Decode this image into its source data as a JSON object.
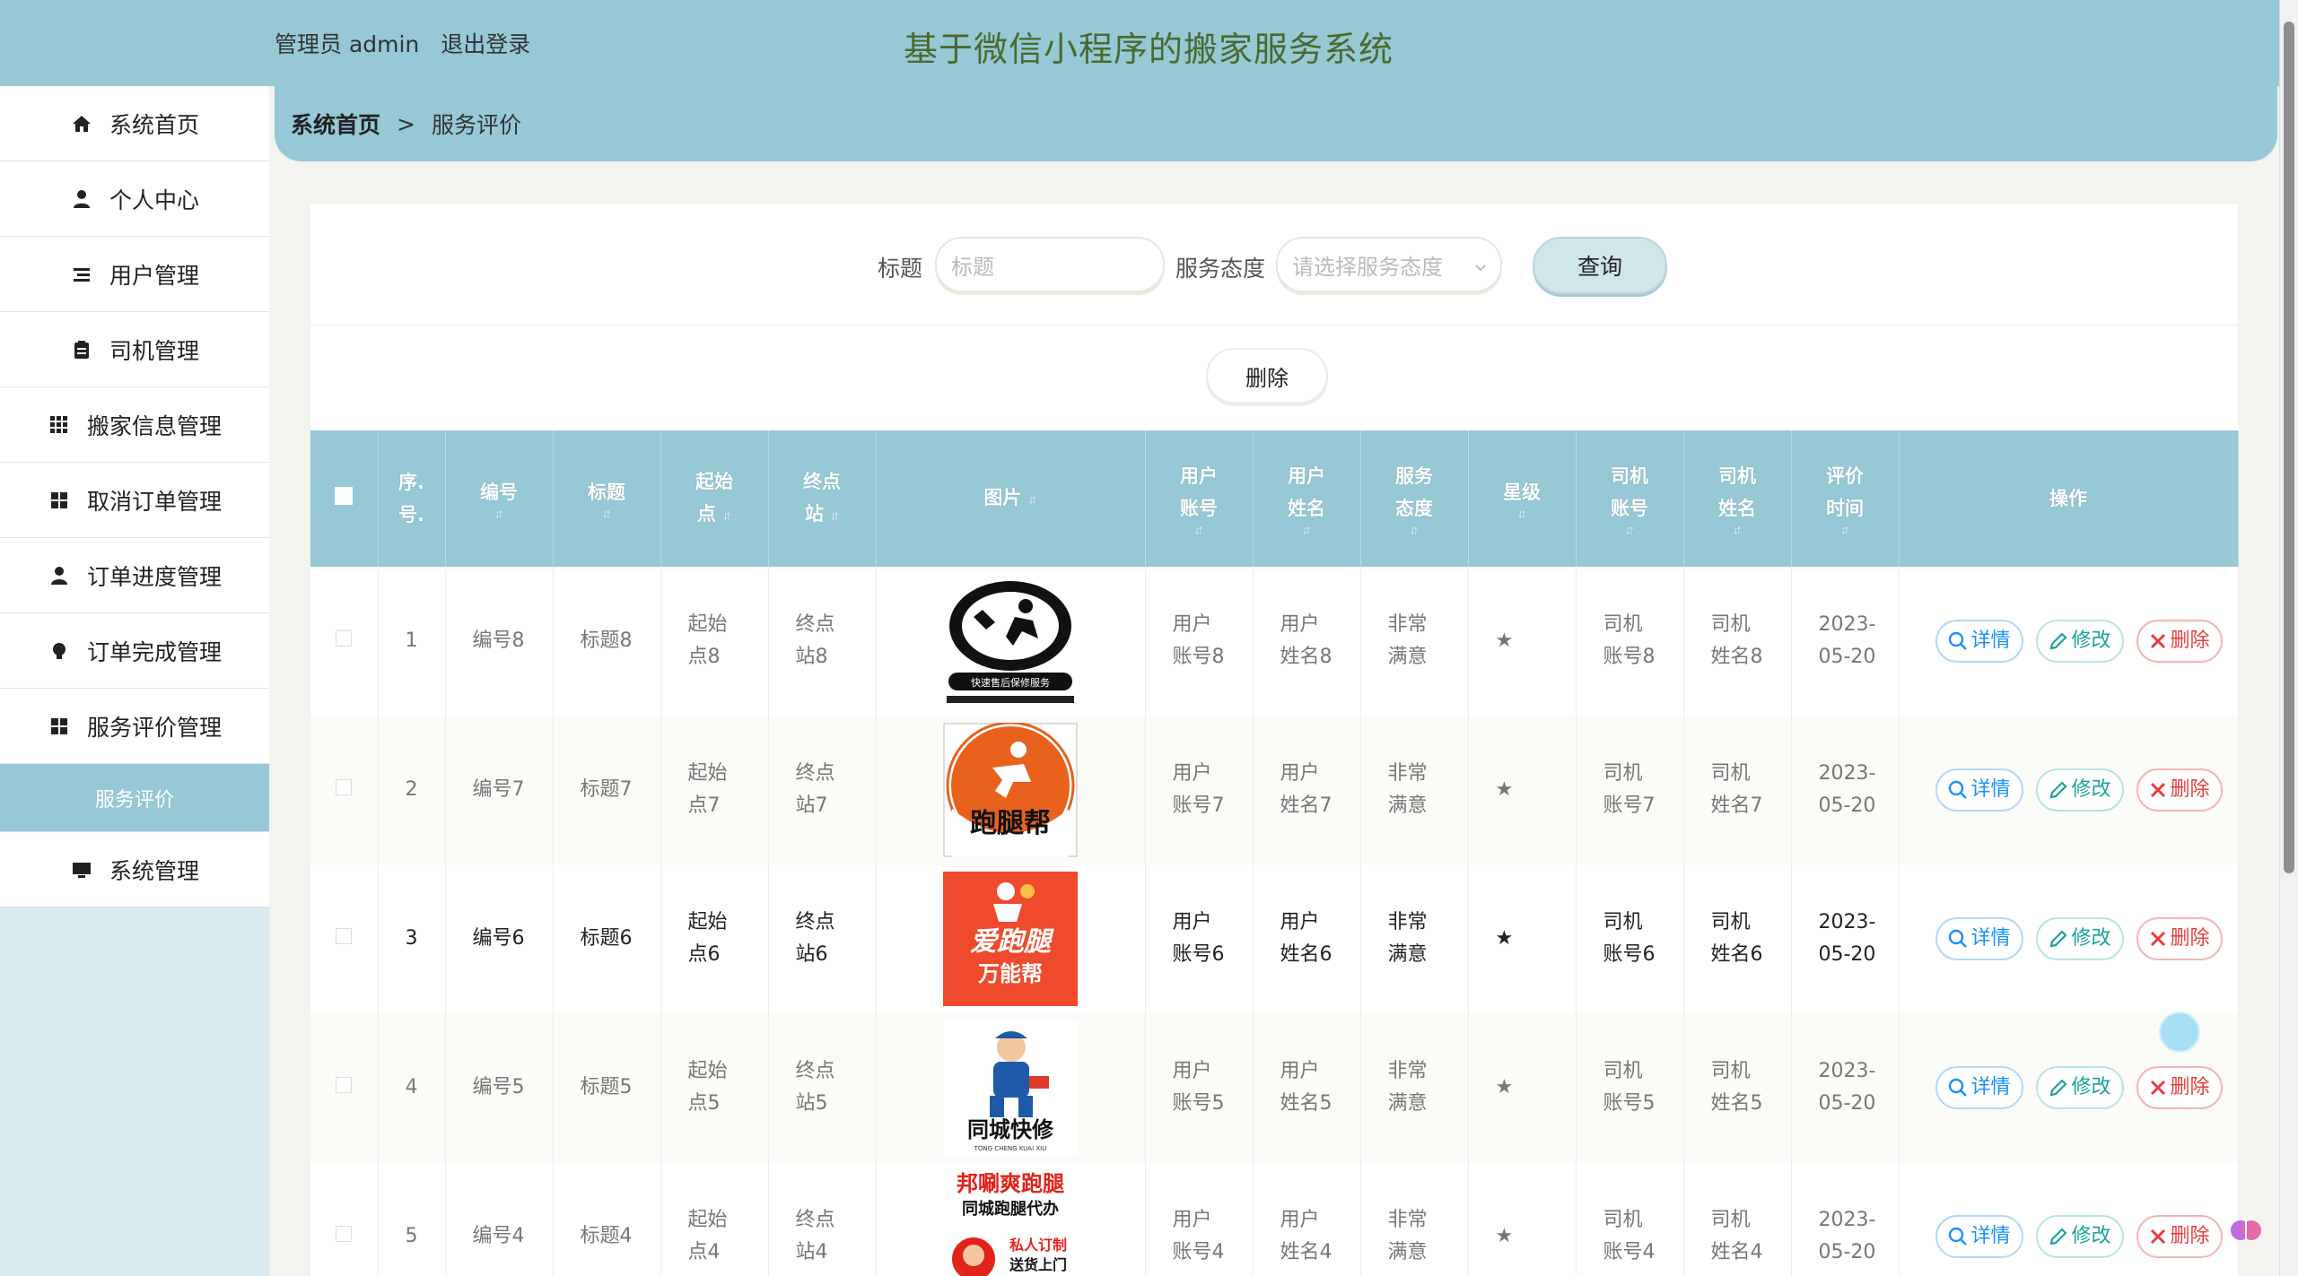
{
  "header": {
    "user_text": "管理员 admin",
    "logout": "退出登录",
    "title": "基于微信小程序的搬家服务系统"
  },
  "sidebar": {
    "items": [
      {
        "label": "系统首页",
        "icon": "home-icon"
      },
      {
        "label": "个人中心",
        "icon": "user-icon"
      },
      {
        "label": "用户管理",
        "icon": "list-icon"
      },
      {
        "label": "司机管理",
        "icon": "clipboard-icon"
      },
      {
        "label": "搬家信息管理",
        "icon": "grid-icon"
      },
      {
        "label": "取消订单管理",
        "icon": "apps-icon"
      },
      {
        "label": "订单进度管理",
        "icon": "person-icon"
      },
      {
        "label": "订单完成管理",
        "icon": "bulb-icon"
      },
      {
        "label": "服务评价管理",
        "icon": "apps-icon"
      }
    ],
    "sub_item": "服务评价",
    "last_item": {
      "label": "系统管理",
      "icon": "monitor-icon"
    }
  },
  "breadcrumb": {
    "home": "系统首页",
    "separator": ">",
    "current": "服务评价"
  },
  "search": {
    "title_label": "标题",
    "title_placeholder": "标题",
    "attitude_label": "服务态度",
    "attitude_placeholder": "请选择服务态度",
    "query_button": "查询"
  },
  "delete_button": "删除",
  "table": {
    "headers": [
      "序号.",
      "编号",
      "标题",
      "起始点",
      "终点站",
      "图片",
      "用户账号",
      "用户姓名",
      "服务态度",
      "星级",
      "司机账号",
      "司机姓名",
      "评价时间",
      "操作"
    ],
    "header_lines": {
      "index": [
        "序.",
        "号."
      ],
      "code": [
        "编号"
      ],
      "title": [
        "标题"
      ],
      "start": [
        "起始",
        "点"
      ],
      "end": [
        "终点",
        "站"
      ],
      "image": [
        "图片"
      ],
      "user_account": [
        "用户",
        "账号"
      ],
      "user_name": [
        "用户",
        "姓名"
      ],
      "attitude": [
        "服务",
        "态度"
      ],
      "stars": [
        "星级"
      ],
      "driver_account": [
        "司机",
        "账号"
      ],
      "driver_name": [
        "司机",
        "姓名"
      ],
      "time": [
        "评价",
        "时间"
      ],
      "ops": [
        "操作"
      ]
    },
    "rows": [
      {
        "index": "1",
        "code": "编号8",
        "title": "标题8",
        "start": [
          "起始",
          "点8"
        ],
        "end": [
          "终点",
          "站8"
        ],
        "image": "快速售后保修服务 logo",
        "user_account": [
          "用户",
          "账号8"
        ],
        "user_name": [
          "用户",
          "姓名8"
        ],
        "attitude": [
          "非常",
          "满意"
        ],
        "stars": "★",
        "driver_account": [
          "司机",
          "账号8"
        ],
        "driver_name": [
          "司机",
          "姓名8"
        ],
        "time": [
          "2023-",
          "05-20"
        ]
      },
      {
        "index": "2",
        "code": "编号7",
        "title": "标题7",
        "start": [
          "起始",
          "点7"
        ],
        "end": [
          "终点",
          "站7"
        ],
        "image": "跑腿帮",
        "user_account": [
          "用户",
          "账号7"
        ],
        "user_name": [
          "用户",
          "姓名7"
        ],
        "attitude": [
          "非常",
          "满意"
        ],
        "stars": "★",
        "driver_account": [
          "司机",
          "账号7"
        ],
        "driver_name": [
          "司机",
          "姓名7"
        ],
        "time": [
          "2023-",
          "05-20"
        ]
      },
      {
        "index": "3",
        "code": "编号6",
        "title": "标题6",
        "start": [
          "起始",
          "点6"
        ],
        "end": [
          "终点",
          "站6"
        ],
        "image": "爱跑腿 万能帮",
        "user_account": [
          "用户",
          "账号6"
        ],
        "user_name": [
          "用户",
          "姓名6"
        ],
        "attitude": [
          "非常",
          "满意"
        ],
        "stars": "★",
        "driver_account": [
          "司机",
          "账号6"
        ],
        "driver_name": [
          "司机",
          "姓名6"
        ],
        "time": [
          "2023-",
          "05-20"
        ]
      },
      {
        "index": "4",
        "code": "编号5",
        "title": "标题5",
        "start": [
          "起始",
          "点5"
        ],
        "end": [
          "终点",
          "站5"
        ],
        "image": "同城快修",
        "user_account": [
          "用户",
          "账号5"
        ],
        "user_name": [
          "用户",
          "姓名5"
        ],
        "attitude": [
          "非常",
          "满意"
        ],
        "stars": "★",
        "driver_account": [
          "司机",
          "账号5"
        ],
        "driver_name": [
          "司机",
          "姓名5"
        ],
        "time": [
          "2023-",
          "05-20"
        ]
      },
      {
        "index": "5",
        "code": "编号4",
        "title": "标题4",
        "start": [
          "起始",
          "点4"
        ],
        "end": [
          "终点",
          "站4"
        ],
        "image": "邦唰爽跑腿 同城跑腿代办",
        "user_account": [
          "用户",
          "账号4"
        ],
        "user_name": [
          "用户",
          "姓名4"
        ],
        "attitude": [
          "非常",
          "满意"
        ],
        "stars": "★",
        "driver_account": [
          "司机",
          "账号4"
        ],
        "driver_name": [
          "司机",
          "姓名4"
        ],
        "time": [
          "2023-",
          "05-20"
        ]
      }
    ],
    "ops": {
      "detail": "详情",
      "edit": "修改",
      "delete": "删除"
    }
  },
  "logos": {
    "logo1_caption": "快速售后保修服务",
    "logo2_text": "跑腿帮",
    "logo3_line1": "爱跑腿",
    "logo3_line2": "万能帮",
    "logo4_text": "同城快修",
    "logo4_sub": "TONG CHENG KUAI XIU",
    "logo5_line1": "邦唰爽跑腿",
    "logo5_line2": "同城跑腿代办",
    "logo5_line3": "私人订制",
    "logo5_line4": "送货上门"
  },
  "colors": {
    "header_bg": "#96c8d6",
    "title_text": "#4a6a2e",
    "detail": "#1890ff",
    "edit": "#1aa39a",
    "delete": "#e83c3c"
  }
}
